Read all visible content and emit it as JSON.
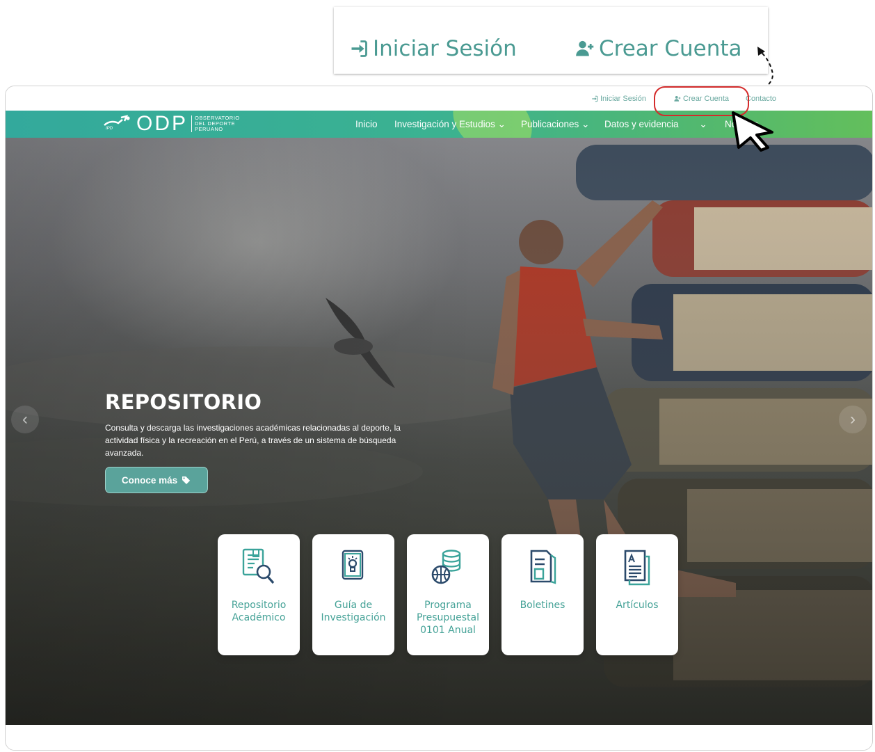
{
  "zoom": {
    "login_label": "Iniciar Sesión",
    "create_label": "Crear Cuenta"
  },
  "topbar": {
    "login_label": "Iniciar Sesión",
    "create_label": "Crear Cuenta",
    "contact_label": "Contacto"
  },
  "nav": {
    "logo_text": "ODP",
    "logo_badge": "IPD",
    "logo_sub": [
      "OBSERVATORIO",
      "DEL DEPORTE",
      "PERUANO"
    ],
    "items": [
      "Inicio",
      "Investigación y Estudios",
      "Publicaciones",
      "Datos y evidencia",
      "Noticias"
    ]
  },
  "hero": {
    "title": "REPOSITORIO",
    "description": "Consulta y descarga las investigaciones académicas relacionadas al deporte, la actividad física y la recreación en el Perú, a través de un sistema de búsqueda avanzada.",
    "button_label": "Conoce más"
  },
  "cards": [
    {
      "label": "Repositorio\nAcadémico",
      "icon": "repository-search-icon"
    },
    {
      "label": "Guía de\nInvestigación",
      "icon": "research-guide-icon"
    },
    {
      "label": "Programa\nPresupuestal\n0101 Anual",
      "icon": "budget-program-icon"
    },
    {
      "label": "Boletines",
      "icon": "bulletins-icon"
    },
    {
      "label": "Artículos",
      "icon": "articles-icon"
    }
  ],
  "colors": {
    "accent": "#45a297",
    "nav_start": "#33a99c",
    "nav_end": "#63bf5c",
    "highlight": "#d42b2b"
  }
}
